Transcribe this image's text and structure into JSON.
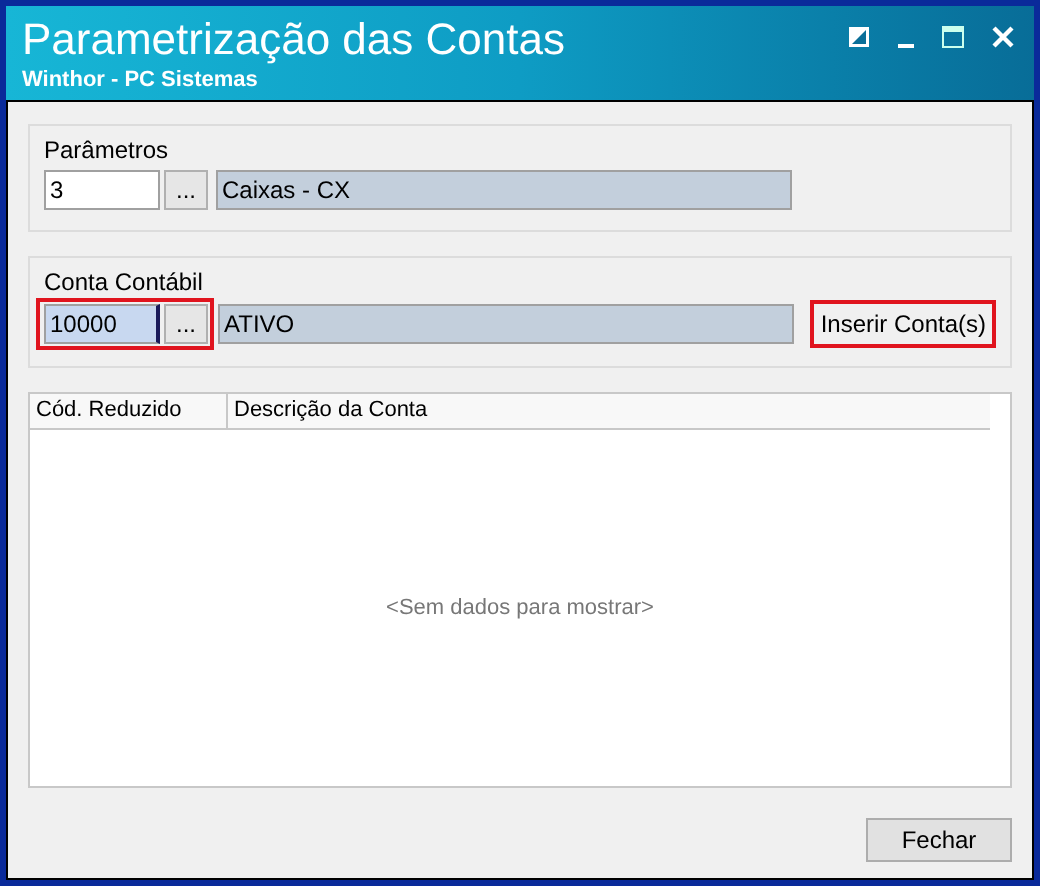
{
  "window": {
    "title": "Parametrização das Contas",
    "subtitle": "Winthor - PC Sistemas"
  },
  "parametros": {
    "label": "Parâmetros",
    "code": "3",
    "lookup_button": "...",
    "description": "Caixas - CX",
    "highlighted": false
  },
  "conta_contabil": {
    "label": "Conta Contábil",
    "code": "10000",
    "lookup_button": "...",
    "description": "ATIVO",
    "highlighted": true,
    "insert_button": {
      "label": "Inserir Conta(s)",
      "highlighted": true
    }
  },
  "table": {
    "columns": [
      "Cód. Reduzido",
      "Descrição da Conta"
    ],
    "empty_message": "<Sem dados para mostrar>"
  },
  "buttons": [
    "Fechar"
  ]
}
